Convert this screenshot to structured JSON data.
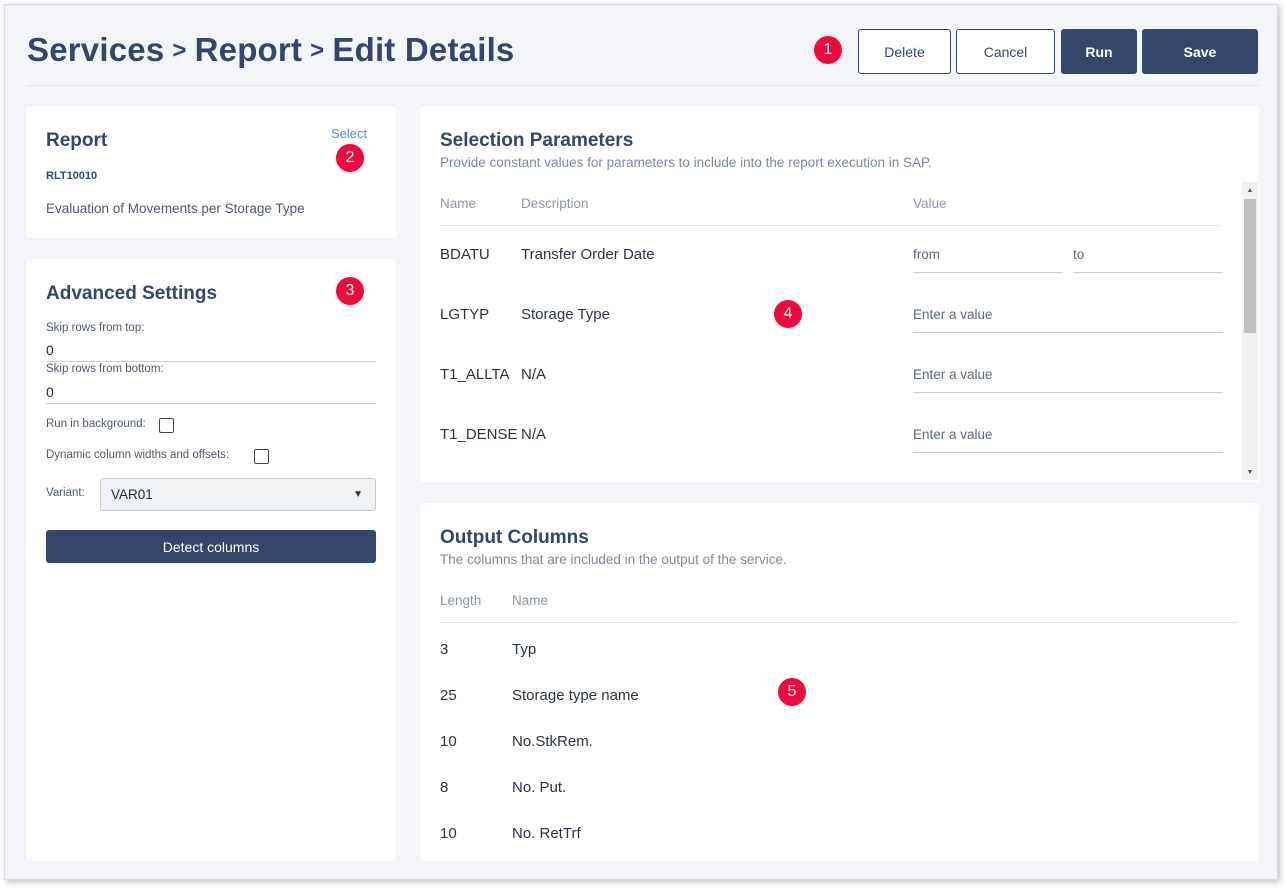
{
  "header": {
    "breadcrumb": [
      "Services",
      "Report",
      "Edit Details"
    ],
    "separator": ">",
    "buttons": {
      "delete": "Delete",
      "cancel": "Cancel",
      "run": "Run",
      "save": "Save"
    }
  },
  "badges": [
    "1",
    "2",
    "3",
    "4",
    "5"
  ],
  "report": {
    "title": "Report",
    "select_label": "Select",
    "code": "RLT10010",
    "description": "Evaluation of Movements per Storage Type"
  },
  "advanced": {
    "title": "Advanced Settings",
    "skip_top_label": "Skip rows from top:",
    "skip_top_value": "0",
    "skip_bottom_label": "Skip rows from bottom:",
    "skip_bottom_value": "0",
    "run_bg_label": "Run in background:",
    "dynamic_label": "Dynamic column widths and offsets:",
    "variant_label": "Variant:",
    "variant_value": "VAR01",
    "detect_button": "Detect columns"
  },
  "selection": {
    "title": "Selection Parameters",
    "subtitle": "Provide constant values for parameters to include into the report execution in SAP.",
    "headers": {
      "name": "Name",
      "description": "Description",
      "value": "Value"
    },
    "rows": [
      {
        "name": "BDATU",
        "description": "Transfer Order Date",
        "from": "from",
        "to": "to"
      },
      {
        "name": "LGTYP",
        "description": "Storage Type",
        "placeholder": "Enter a value"
      },
      {
        "name": "T1_ALLTA",
        "description": "N/A",
        "placeholder": "Enter a value"
      },
      {
        "name": "T1_DENSE",
        "description": "N/A",
        "placeholder": "Enter a value"
      }
    ]
  },
  "output": {
    "title": "Output Columns",
    "subtitle": "The columns that are included in the output of the service.",
    "headers": {
      "length": "Length",
      "name": "Name"
    },
    "rows": [
      {
        "length": "3",
        "name": "Typ"
      },
      {
        "length": "25",
        "name": "Storage type name"
      },
      {
        "length": "10",
        "name": "No.StkRem."
      },
      {
        "length": "8",
        "name": "No. Put."
      },
      {
        "length": "10",
        "name": "No. RetTrf"
      }
    ]
  },
  "colors": {
    "primary": "#34466a",
    "badge": "#ec0b3d",
    "link": "#4a90e2",
    "background": "#f3f5f8"
  }
}
